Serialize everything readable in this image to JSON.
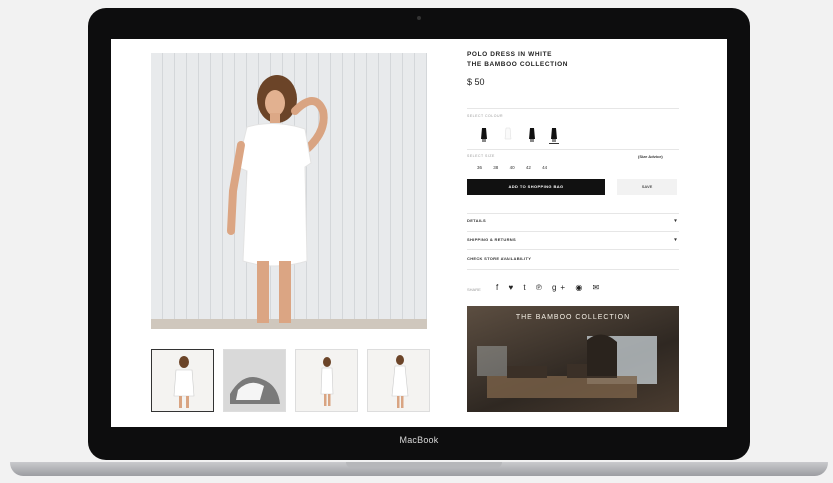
{
  "device": {
    "brand": "MacBook"
  },
  "product": {
    "title_line1": "POLO DRESS IN WHITE",
    "title_line2": "THE BAMBOO COLLECTION",
    "price": "$ 50"
  },
  "labels": {
    "select_colour": "SELECT COLOUR",
    "select_size": "SELECT SIZE",
    "size_advice": "(Size Advice)",
    "share": "SHARE"
  },
  "sizes": [
    "36",
    "38",
    "40",
    "42",
    "44"
  ],
  "actions": {
    "add_to_bag": "ADD TO SHOPPING BAG",
    "save": "SAVE"
  },
  "accordions": [
    {
      "label": "DETAILS",
      "chevron": "▾"
    },
    {
      "label": "SHIPPING & RETURNS",
      "chevron": "▾"
    },
    {
      "label": "CHECK STORE AVAILABILITY"
    }
  ],
  "social_icons": [
    "facebook-icon",
    "twitter-icon",
    "tumblr-icon",
    "pinterest-icon",
    "google-plus-icon",
    "pin-icon",
    "mail-icon"
  ],
  "social_glyphs": "f ♥ t ℗ g+ ◉ ✉",
  "banner": {
    "headline": "THE BAMBOO COLLECTION"
  }
}
